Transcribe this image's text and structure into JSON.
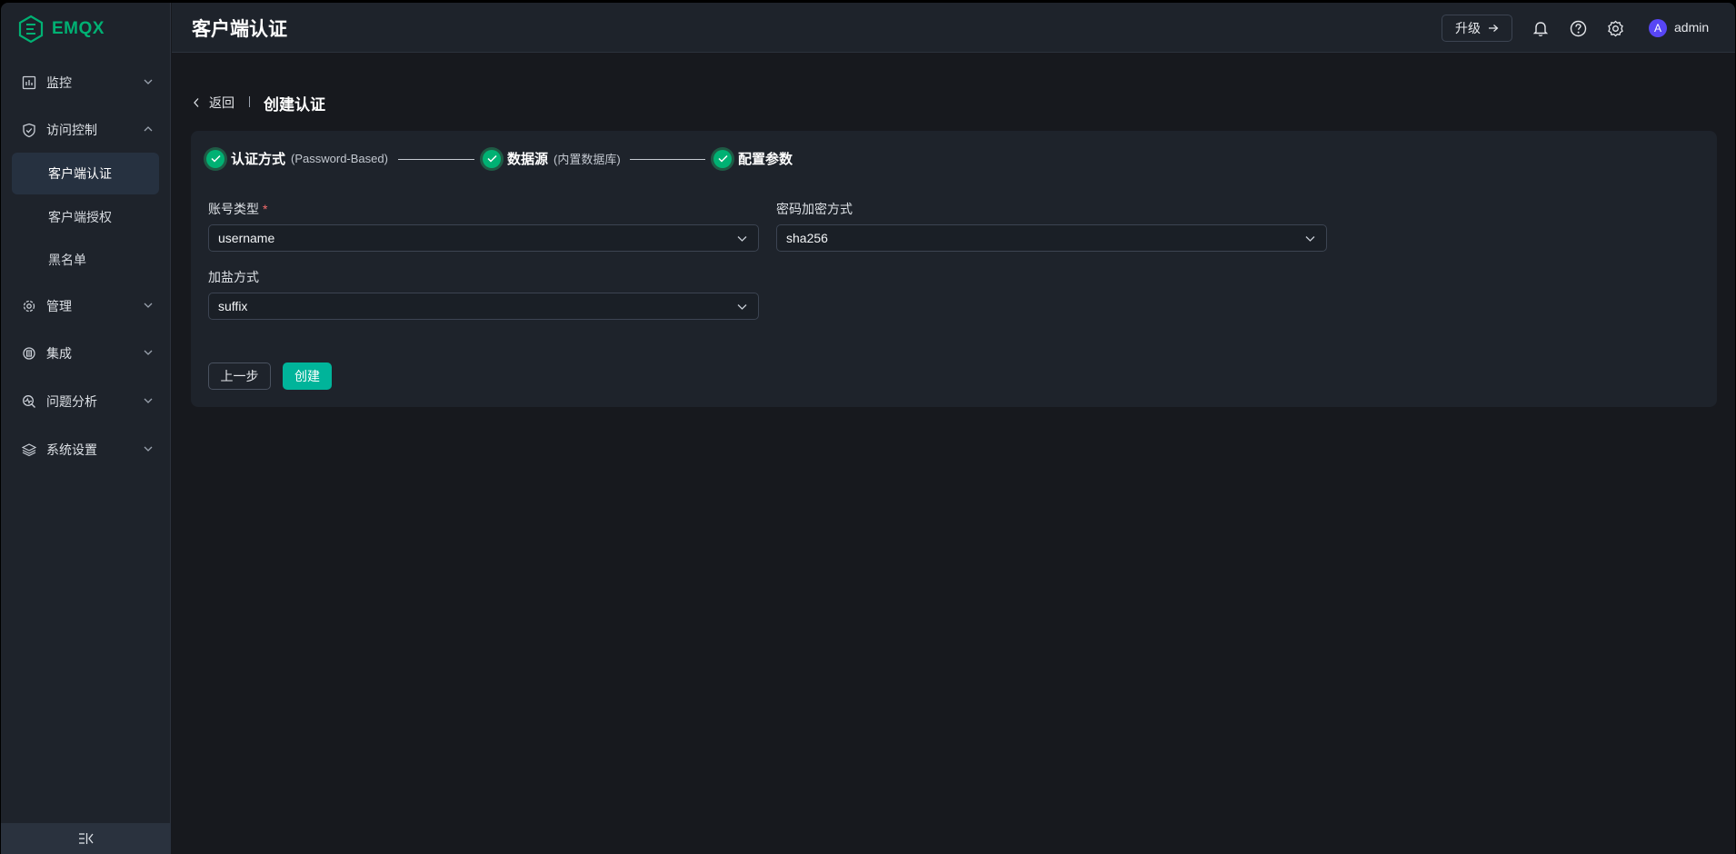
{
  "colors": {
    "accent": "#00b173",
    "primary_button": "#00b49a",
    "avatar": "#5846f5",
    "required": "#f56c6c"
  },
  "sidebar": {
    "logo_text": "EMQX",
    "items": [
      {
        "label": "监控",
        "icon": "monitor-chart-icon",
        "expanded": false
      },
      {
        "label": "访问控制",
        "icon": "shield-check-icon",
        "expanded": true
      },
      {
        "label": "管理",
        "icon": "management-gear-icon",
        "expanded": false
      },
      {
        "label": "集成",
        "icon": "integration-icon",
        "expanded": false
      },
      {
        "label": "问题分析",
        "icon": "diagnosis-icon",
        "expanded": false
      },
      {
        "label": "系统设置",
        "icon": "layers-icon",
        "expanded": false
      }
    ],
    "sub_items": [
      {
        "label": "客户端认证",
        "active": true
      },
      {
        "label": "客户端授权",
        "active": false
      },
      {
        "label": "黑名单",
        "active": false
      }
    ],
    "collapse_icon": "collapse-sidebar-icon"
  },
  "header": {
    "title": "客户端认证",
    "upgrade_label": "升级",
    "avatar_letter": "A",
    "username": "admin"
  },
  "breadcrumb": {
    "back_label": "返回",
    "title": "创建认证"
  },
  "steps": [
    {
      "title": "认证方式",
      "desc": "(Password-Based)"
    },
    {
      "title": "数据源",
      "desc": "(内置数据库)"
    },
    {
      "title": "配置参数",
      "desc": ""
    }
  ],
  "form": {
    "account_type": {
      "label": "账号类型",
      "required_mark": "*",
      "value": "username"
    },
    "password_hash": {
      "label": "密码加密方式",
      "value": "sha256"
    },
    "salt_position": {
      "label": "加盐方式",
      "value": "suffix"
    }
  },
  "actions": {
    "prev_label": "上一步",
    "create_label": "创建"
  }
}
